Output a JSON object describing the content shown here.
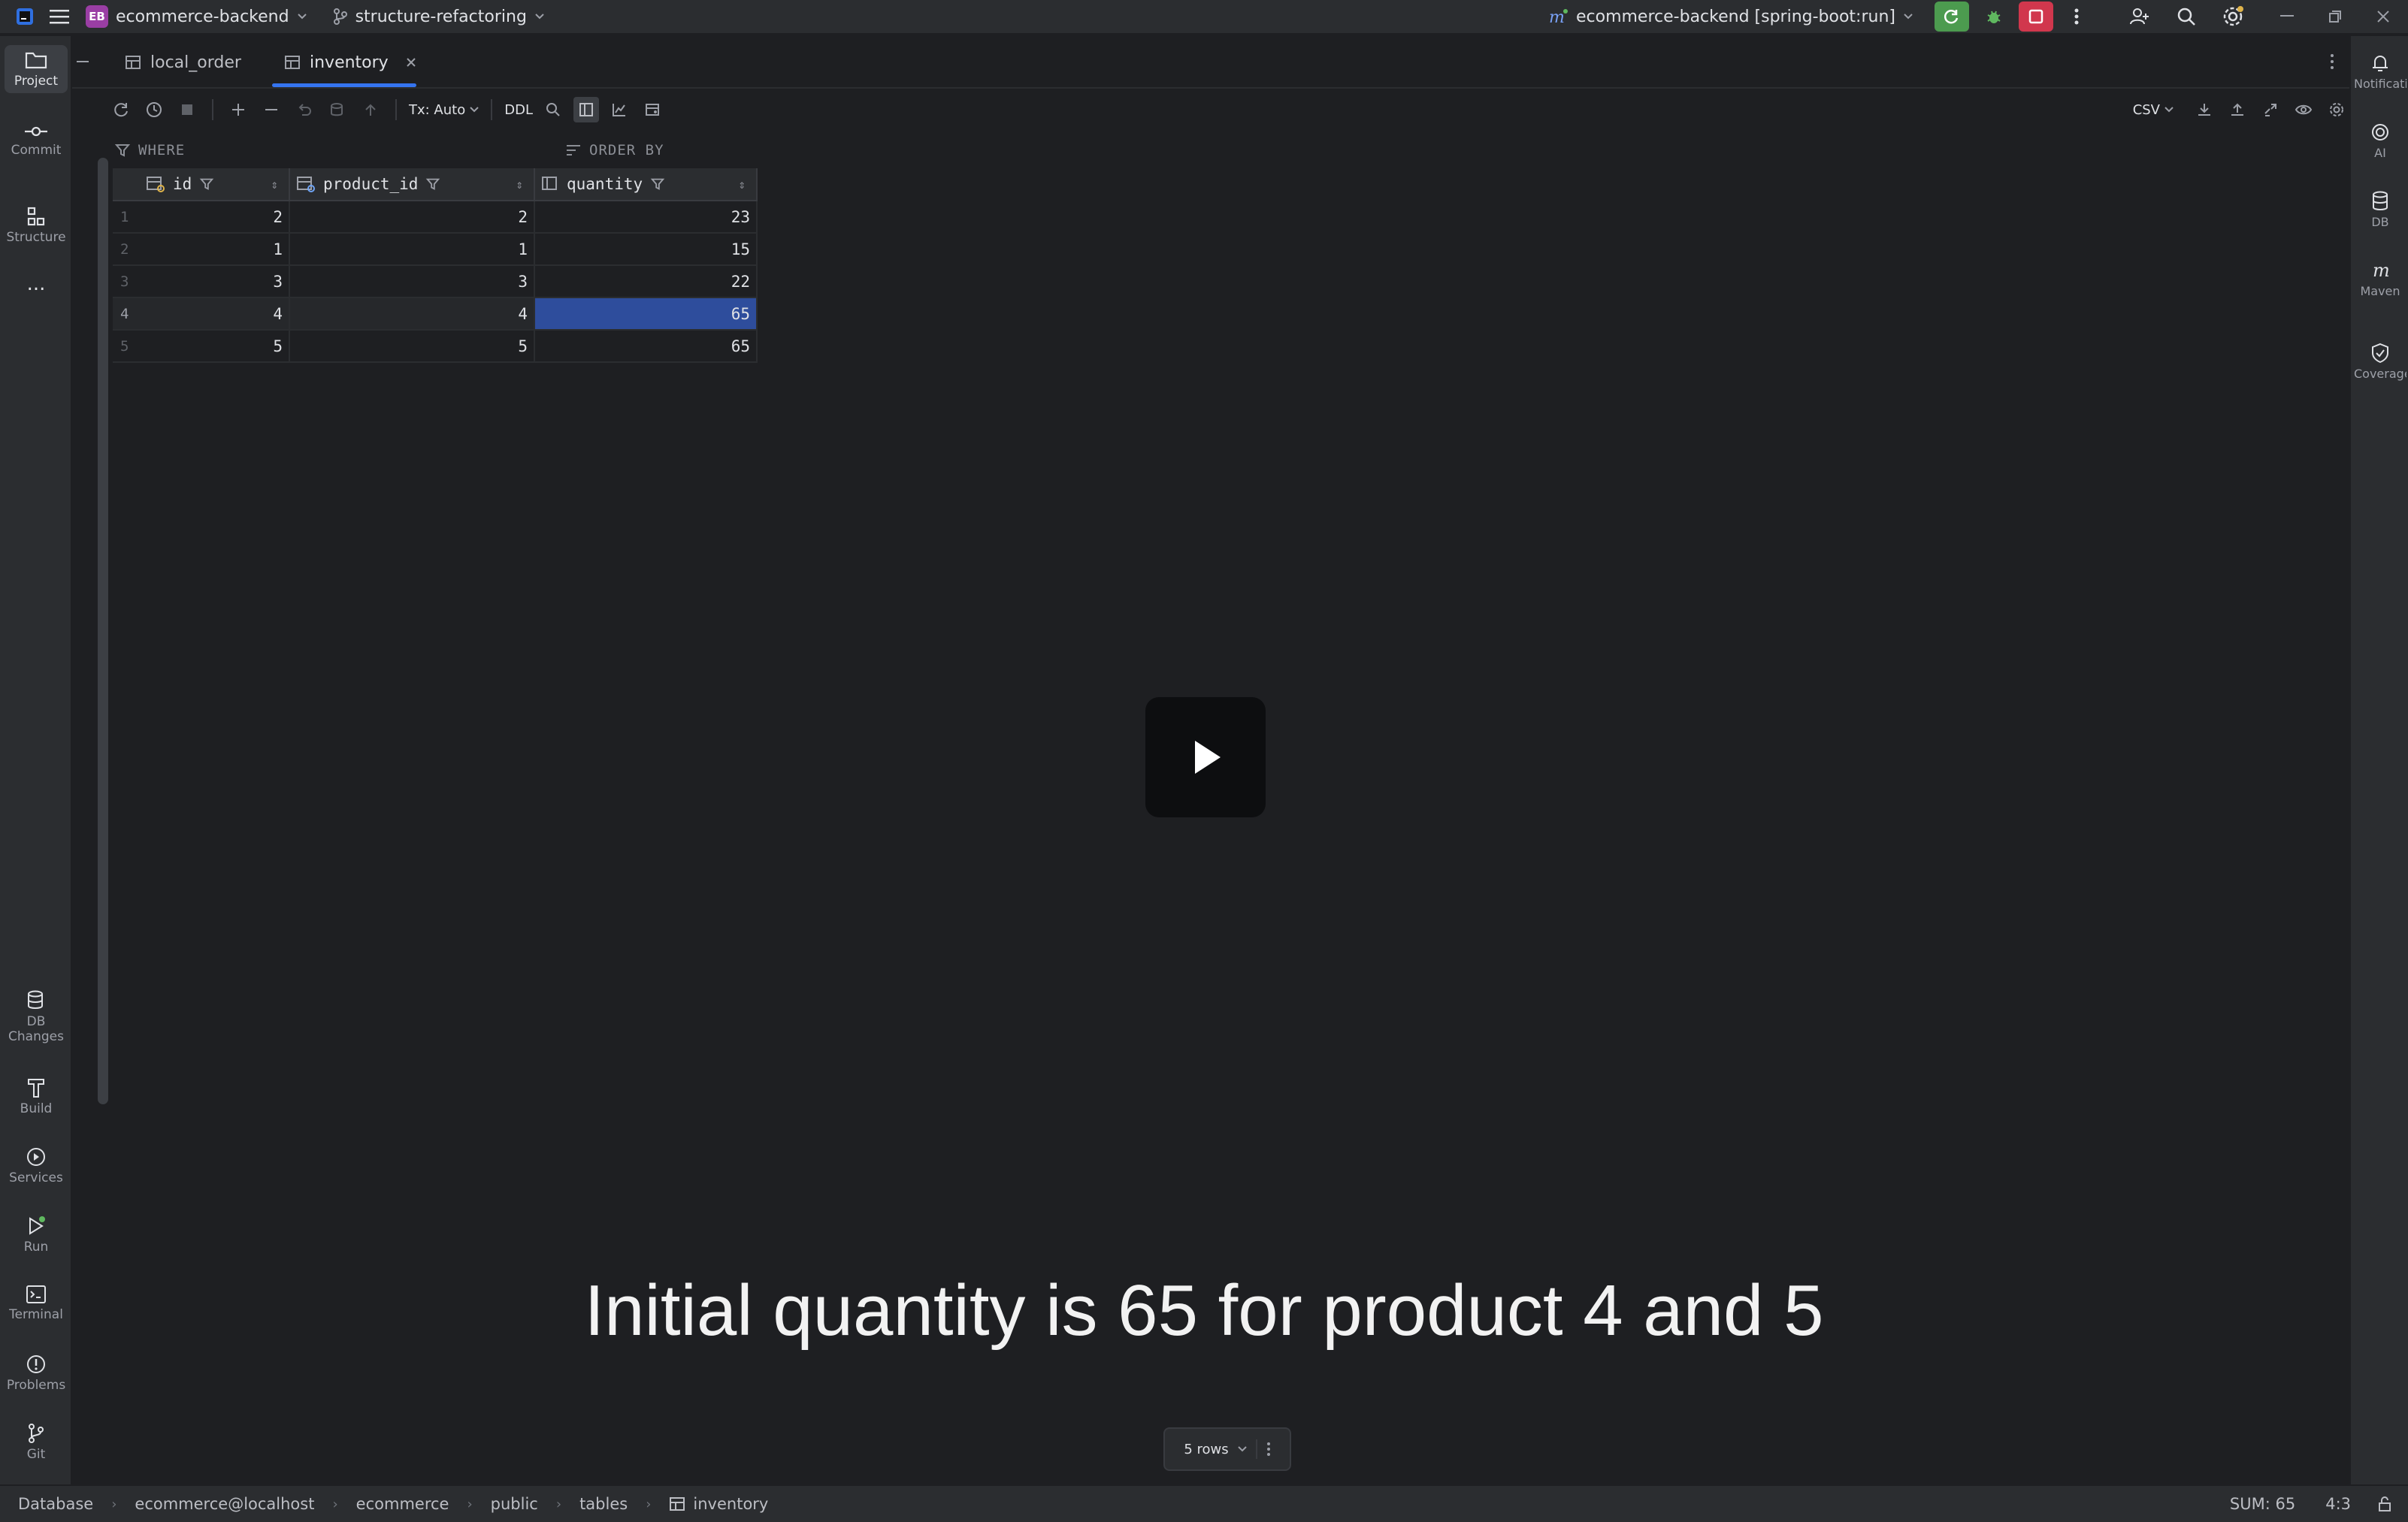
{
  "titlebar": {
    "project_badge": "EB",
    "project_name": "ecommerce-backend",
    "branch": "structure-refactoring",
    "run_config": "ecommerce-backend [spring-boot:run]"
  },
  "left_tools": {
    "project": "Project",
    "commit": "Commit",
    "structure": "Structure",
    "more": "...",
    "db_changes_1": "DB",
    "db_changes_2": "Changes",
    "build": "Build",
    "services": "Services",
    "run": "Run",
    "terminal": "Terminal",
    "problems": "Problems",
    "git": "Git"
  },
  "right_tools": {
    "notifications": "Notifications",
    "ai": "AI",
    "db": "DB",
    "maven": "Maven",
    "coverage": "Coverage"
  },
  "tabs": [
    {
      "label": "local_order"
    },
    {
      "label": "inventory"
    }
  ],
  "toolbar": {
    "tx_mode": "Tx: Auto",
    "ddl": "DDL",
    "export_format": "CSV"
  },
  "filter": {
    "where": "WHERE",
    "order_by": "ORDER BY"
  },
  "grid": {
    "columns": [
      "id",
      "product_id",
      "quantity"
    ],
    "rows": [
      {
        "num": "1",
        "id": "2",
        "product_id": "2",
        "quantity": "23"
      },
      {
        "num": "2",
        "id": "1",
        "product_id": "1",
        "quantity": "15"
      },
      {
        "num": "3",
        "id": "3",
        "product_id": "3",
        "quantity": "22"
      },
      {
        "num": "4",
        "id": "4",
        "product_id": "4",
        "quantity": "65"
      },
      {
        "num": "5",
        "id": "5",
        "product_id": "5",
        "quantity": "65"
      }
    ],
    "selected_row": 4
  },
  "caption": "Initial quantity is 65 for product 4 and 5",
  "rows_pill": "5 rows",
  "statusbar": {
    "crumbs": [
      "Database",
      "ecommerce@localhost",
      "ecommerce",
      "public",
      "tables",
      "inventory"
    ],
    "sum": "SUM: 65",
    "position": "4:3"
  },
  "colors": {
    "accent": "#3574f0",
    "selection": "#2e4d9c",
    "background": "#1e1f22",
    "panel": "#2b2d30"
  }
}
